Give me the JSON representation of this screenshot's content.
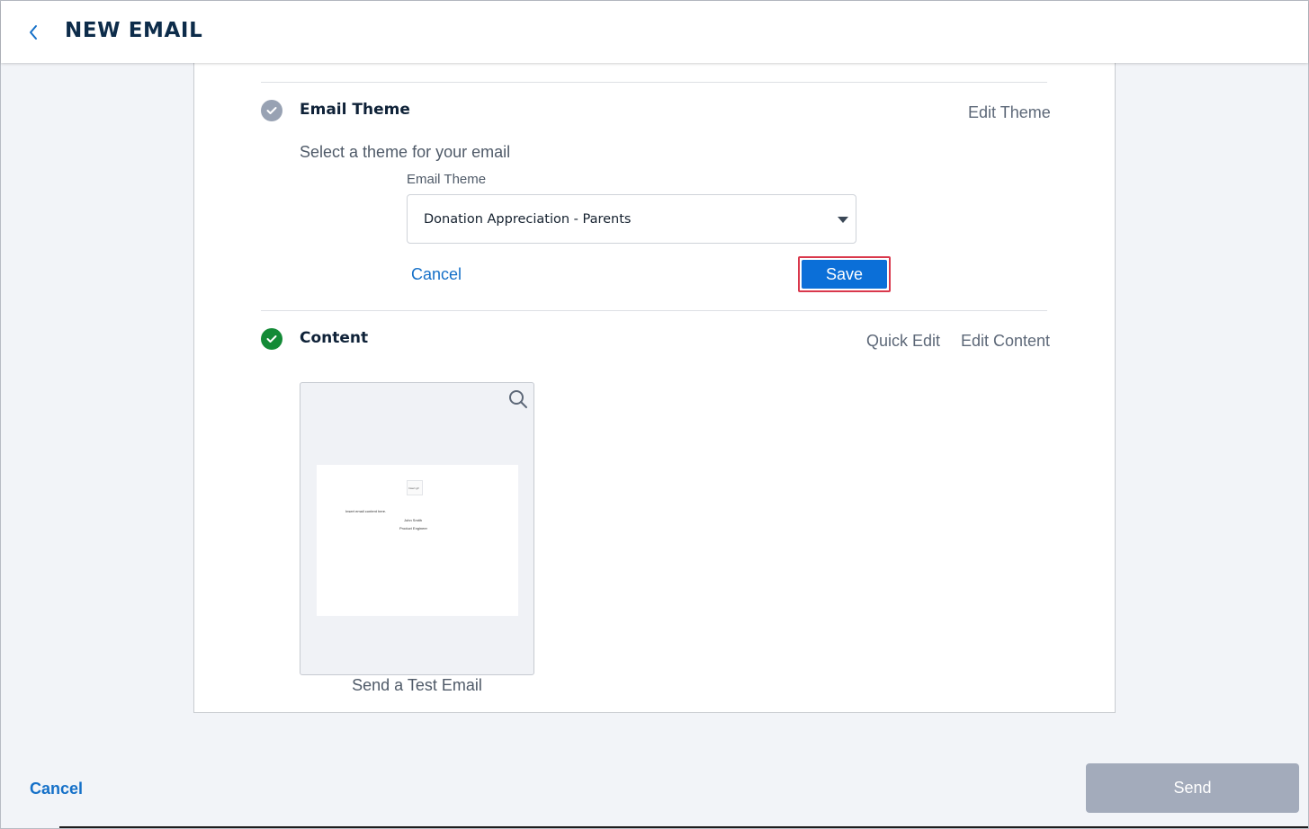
{
  "header": {
    "title": "NEW EMAIL",
    "back_icon": "chevron-left-icon"
  },
  "theme_step": {
    "title": "Email Theme",
    "status_icon": "check-circle-icon",
    "action_label": "Edit Theme",
    "subtitle": "Select a theme for your email",
    "field_label": "Email Theme",
    "selected_value": "Donation Appreciation - Parents",
    "cancel_label": "Cancel",
    "save_label": "Save"
  },
  "content_step": {
    "title": "Content",
    "status_icon": "check-circle-icon",
    "quick_edit_label": "Quick Edit",
    "edit_content_label": "Edit Content",
    "preview": {
      "image_label": "Insert gif",
      "body_text": "Insert email content here.",
      "signature_name": "John Smith",
      "signature_title": "Product Engineer"
    },
    "send_test_label": "Send a Test Email"
  },
  "footer": {
    "cancel_label": "Cancel",
    "send_label": "Send"
  },
  "colors": {
    "primary": "#0b6fd8",
    "link": "#1570c8",
    "success": "#138a36",
    "highlight": "#d9384c",
    "disabled": "#a3abbb"
  }
}
